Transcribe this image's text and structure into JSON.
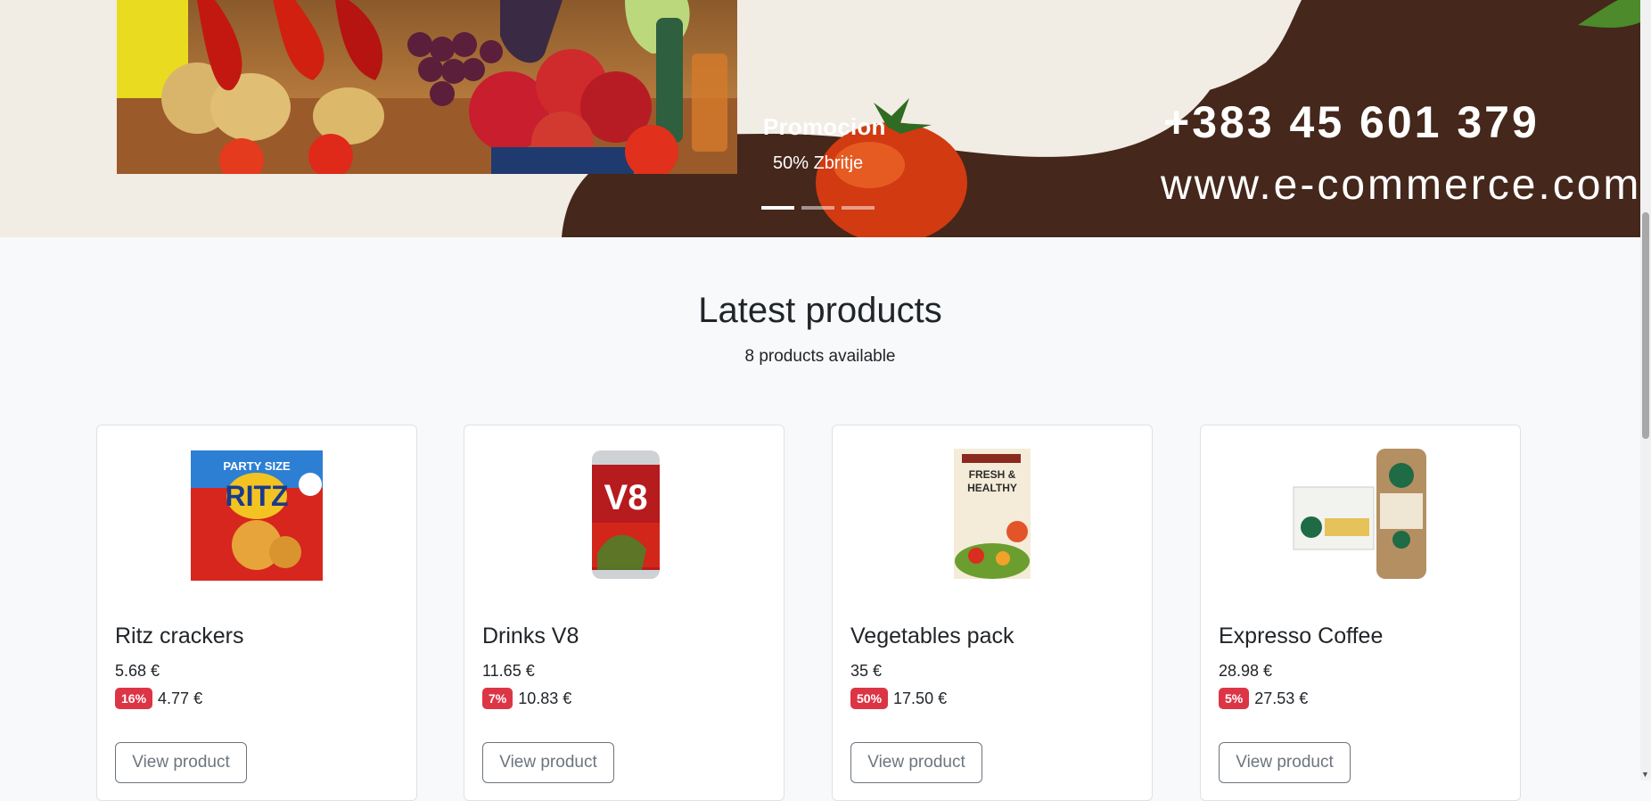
{
  "banner": {
    "promo_title": "Promocion",
    "promo_subtitle": "50% Zbritje",
    "phone": "+383 45 601 379",
    "website": "www.e-commerce.com",
    "slides": 3,
    "active_slide": 1
  },
  "section": {
    "title": "Latest products",
    "subtitle": "8 products available"
  },
  "products": [
    {
      "name": "Ritz crackers",
      "price": "5.68 €",
      "discount": "16%",
      "sale_price": "4.77 €",
      "button": "View product",
      "image": "ritz-box-image"
    },
    {
      "name": "Drinks V8",
      "price": "11.65 €",
      "discount": "7%",
      "sale_price": "10.83 €",
      "button": "View product",
      "image": "v8-can-image"
    },
    {
      "name": "Vegetables pack",
      "price": "35 €",
      "discount": "50%",
      "sale_price": "17.50 €",
      "button": "View product",
      "image": "vegetables-flyer-image"
    },
    {
      "name": "Expresso Coffee",
      "price": "28.98 €",
      "discount": "5%",
      "sale_price": "27.53 €",
      "button": "View product",
      "image": "starbucks-doubleshot-image"
    }
  ],
  "colors": {
    "banner_bg": "#f1ece4",
    "banner_dark": "#45271b",
    "badge": "#dc3545",
    "page_bg": "#f8f9fa",
    "button_border": "#6c757d"
  }
}
